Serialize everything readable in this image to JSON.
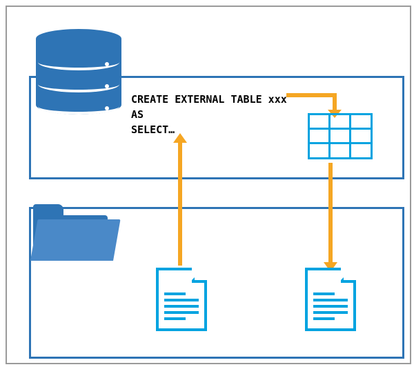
{
  "sql": {
    "line1": "CREATE EXTERNAL TABLE xxx",
    "line2": "AS",
    "line3": "SELECT…"
  },
  "icons": {
    "database": "database-cylinder",
    "folder": "folder",
    "table": "data-grid",
    "file_source": "document-source",
    "file_output": "document-output"
  },
  "arrows": {
    "file_to_sql": "up",
    "sql_to_table": "right-down",
    "table_to_file": "down"
  },
  "colors": {
    "container": "#2e74b5",
    "accent": "#00a3e0",
    "arrow": "#f5a623",
    "folder_front": "#4a89c8"
  }
}
